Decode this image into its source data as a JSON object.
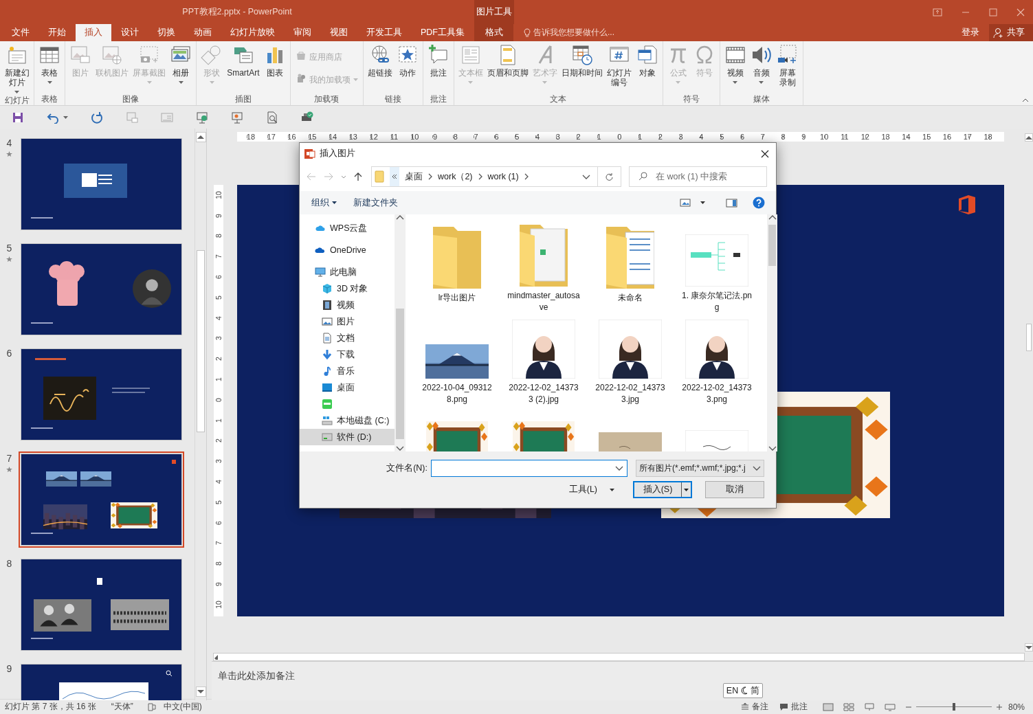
{
  "window": {
    "title": "PPT教程2.pptx - PowerPoint",
    "context_label": "图片工具"
  },
  "tabs": [
    {
      "label": "文件",
      "selected": false,
      "kind": "normal"
    },
    {
      "label": "开始",
      "selected": false,
      "kind": "normal"
    },
    {
      "label": "插入",
      "selected": true,
      "kind": "normal"
    },
    {
      "label": "设计",
      "selected": false,
      "kind": "normal"
    },
    {
      "label": "切换",
      "selected": false,
      "kind": "normal"
    },
    {
      "label": "动画",
      "selected": false,
      "kind": "normal"
    },
    {
      "label": "幻灯片放映",
      "selected": false,
      "kind": "normal"
    },
    {
      "label": "审阅",
      "selected": false,
      "kind": "normal"
    },
    {
      "label": "视图",
      "selected": false,
      "kind": "normal"
    },
    {
      "label": "开发工具",
      "selected": false,
      "kind": "normal"
    },
    {
      "label": "PDF工具集",
      "selected": false,
      "kind": "normal"
    },
    {
      "label": "格式",
      "selected": false,
      "kind": "contextual"
    }
  ],
  "tell_me": {
    "prompt": "告诉我您想要做什么..."
  },
  "account": {
    "sign_in": "登录",
    "share": "共享"
  },
  "ribbon": {
    "groups": [
      {
        "label": "幻灯片",
        "items": [
          {
            "label": "新建幻灯片",
            "kind": "newslide",
            "disabled": false,
            "dropdown": true,
            "stacked": true
          }
        ]
      },
      {
        "label": "表格",
        "items": [
          {
            "label": "表格",
            "kind": "table",
            "disabled": false,
            "dropdown": true
          }
        ]
      },
      {
        "label": "图像",
        "items": [
          {
            "label": "图片",
            "kind": "picture",
            "disabled": true,
            "dropdown": false
          },
          {
            "label": "联机图片",
            "kind": "online",
            "disabled": true,
            "dropdown": false
          },
          {
            "label": "屏幕截图",
            "kind": "screenshot",
            "disabled": true,
            "dropdown": true
          },
          {
            "label": "相册",
            "kind": "album",
            "disabled": false,
            "dropdown": true
          }
        ]
      },
      {
        "label": "插图",
        "items": [
          {
            "label": "形状",
            "kind": "shapes",
            "disabled": true,
            "dropdown": true
          },
          {
            "label": "SmartArt",
            "kind": "smartart",
            "disabled": false,
            "dropdown": false
          },
          {
            "label": "图表",
            "kind": "chart",
            "disabled": false,
            "dropdown": false
          }
        ]
      },
      {
        "label": "加载项",
        "items": [
          {
            "label": "应用商店",
            "kind": "store",
            "disabled": true,
            "dropdown": false
          },
          {
            "label": "我的加载项",
            "kind": "addins",
            "disabled": true,
            "dropdown": true
          }
        ]
      },
      {
        "label": "链接",
        "items": [
          {
            "label": "超链接",
            "kind": "hyperlink",
            "disabled": false,
            "dropdown": false
          },
          {
            "label": "动作",
            "kind": "action",
            "disabled": false,
            "dropdown": false
          }
        ]
      },
      {
        "label": "批注",
        "items": [
          {
            "label": "批注",
            "kind": "comment",
            "disabled": false,
            "dropdown": false
          }
        ]
      },
      {
        "label": "文本",
        "items": [
          {
            "label": "文本框",
            "kind": "textbox",
            "disabled": true,
            "dropdown": true
          },
          {
            "label": "页眉和页脚",
            "kind": "headerfooter",
            "disabled": false,
            "dropdown": false
          },
          {
            "label": "艺术字",
            "kind": "wordart",
            "disabled": true,
            "dropdown": true
          },
          {
            "label": "日期和时间",
            "kind": "datetime",
            "disabled": false,
            "dropdown": false
          },
          {
            "label": "幻灯片编号",
            "kind": "slidenumber",
            "disabled": false,
            "dropdown": false,
            "stacked": true
          },
          {
            "label": "对象",
            "kind": "object",
            "disabled": false,
            "dropdown": false
          }
        ]
      },
      {
        "label": "符号",
        "items": [
          {
            "label": "公式",
            "kind": "equation",
            "disabled": true,
            "dropdown": true
          },
          {
            "label": "符号",
            "kind": "symbol",
            "disabled": true,
            "dropdown": false
          }
        ]
      },
      {
        "label": "媒体",
        "items": [
          {
            "label": "视频",
            "kind": "video",
            "disabled": false,
            "dropdown": true
          },
          {
            "label": "音频",
            "kind": "audio",
            "disabled": false,
            "dropdown": true
          },
          {
            "label": "屏幕录制",
            "kind": "recording",
            "disabled": false,
            "dropdown": false,
            "stacked": true
          }
        ]
      }
    ]
  },
  "slides": [
    {
      "number": "4",
      "starred": true,
      "selected": false,
      "kind": "document"
    },
    {
      "number": "5",
      "starred": true,
      "selected": false,
      "kind": "portraits"
    },
    {
      "number": "6",
      "starred": false,
      "selected": false,
      "kind": "formula"
    },
    {
      "number": "7",
      "starred": true,
      "selected": true,
      "kind": "photos"
    },
    {
      "number": "8",
      "starred": false,
      "selected": false,
      "kind": "history"
    },
    {
      "number": "9",
      "starred": false,
      "selected": false,
      "kind": "chart"
    }
  ],
  "rulers": {
    "horizontal": [
      "18",
      "17",
      "16",
      "15",
      "14",
      "13",
      "12",
      "11",
      "10",
      "9",
      "8",
      "7",
      "6",
      "5",
      "4",
      "3",
      "2",
      "1",
      "0",
      "1",
      "2",
      "3",
      "4",
      "5",
      "6",
      "7",
      "8",
      "9",
      "10",
      "11",
      "12",
      "13",
      "14",
      "15",
      "16",
      "17",
      "18"
    ],
    "vertical": [
      "10",
      "9",
      "8",
      "7",
      "6",
      "5",
      "4",
      "3",
      "2",
      "1",
      "0",
      "1",
      "2",
      "3",
      "4",
      "5",
      "6",
      "7",
      "8",
      "9",
      "10"
    ]
  },
  "notes": {
    "prompt": "单击此处添加备注"
  },
  "dialog": {
    "title": "插入图片",
    "path": [
      "桌面",
      "work（2)",
      "work (1)"
    ],
    "search": {
      "placeholder": "在 work (1) 中搜索"
    },
    "toolbar": {
      "organize": "组织",
      "new_folder": "新建文件夹"
    },
    "nav": [
      {
        "label": "WPS云盘",
        "kind": "wps",
        "selected": false
      },
      {
        "label": "OneDrive",
        "kind": "onedrive",
        "selected": false
      },
      {
        "label": "此电脑",
        "kind": "pc",
        "selected": false,
        "children": [
          {
            "label": "3D 对象",
            "kind": "cube",
            "selected": false
          },
          {
            "label": "视频",
            "kind": "film",
            "selected": false
          },
          {
            "label": "图片",
            "kind": "pictures",
            "selected": false
          },
          {
            "label": "文档",
            "kind": "docs",
            "selected": false
          },
          {
            "label": "下载",
            "kind": "download",
            "selected": false
          },
          {
            "label": "音乐",
            "kind": "music",
            "selected": false
          },
          {
            "label": "桌面",
            "kind": "desktop",
            "selected": false
          },
          {
            "kind": "app",
            "selected": false
          },
          {
            "label": "本地磁盘 (C:)",
            "kind": "diskc",
            "selected": false
          },
          {
            "label": "软件 (D:)",
            "kind": "disk",
            "selected": true
          }
        ]
      }
    ],
    "files": [
      {
        "name": "lr导出图片",
        "kind": "folder"
      },
      {
        "name": "mindmaster_autosave",
        "kind": "folderdoc"
      },
      {
        "name": "未命名",
        "kind": "folderpages"
      },
      {
        "name": "1. 康奈尔笔记法.png",
        "kind": "mindmap"
      },
      {
        "name": "2022-10-04_093128.png",
        "kind": "mountain"
      },
      {
        "name": "2022-12-02_143733 (2).jpg",
        "kind": "portrait"
      },
      {
        "name": "2022-12-02_143733.jpg",
        "kind": "portrait"
      },
      {
        "name": "2022-12-02_143733.png",
        "kind": "portrait"
      },
      {
        "kind": "chalkboard"
      },
      {
        "kind": "chalkboard"
      },
      {
        "kind": "paper"
      },
      {
        "kind": "note"
      }
    ],
    "filename_label": "文件名(N):",
    "filter": "所有图片(*.emf;*.wmf;*.jpg;*.j",
    "tools": "工具(L)",
    "insert": "插入(S)",
    "cancel": "取消"
  },
  "ime": {
    "mode": "EN",
    "layout": "简"
  },
  "status": {
    "slide_info": "幻灯片 第 7 张，共 16 张",
    "theme": "“天体”",
    "language": "中文(中国)",
    "notes": "备注",
    "comments": "批注",
    "zoom_slider": {
      "level": 0.5
    },
    "zoom": "80%"
  }
}
